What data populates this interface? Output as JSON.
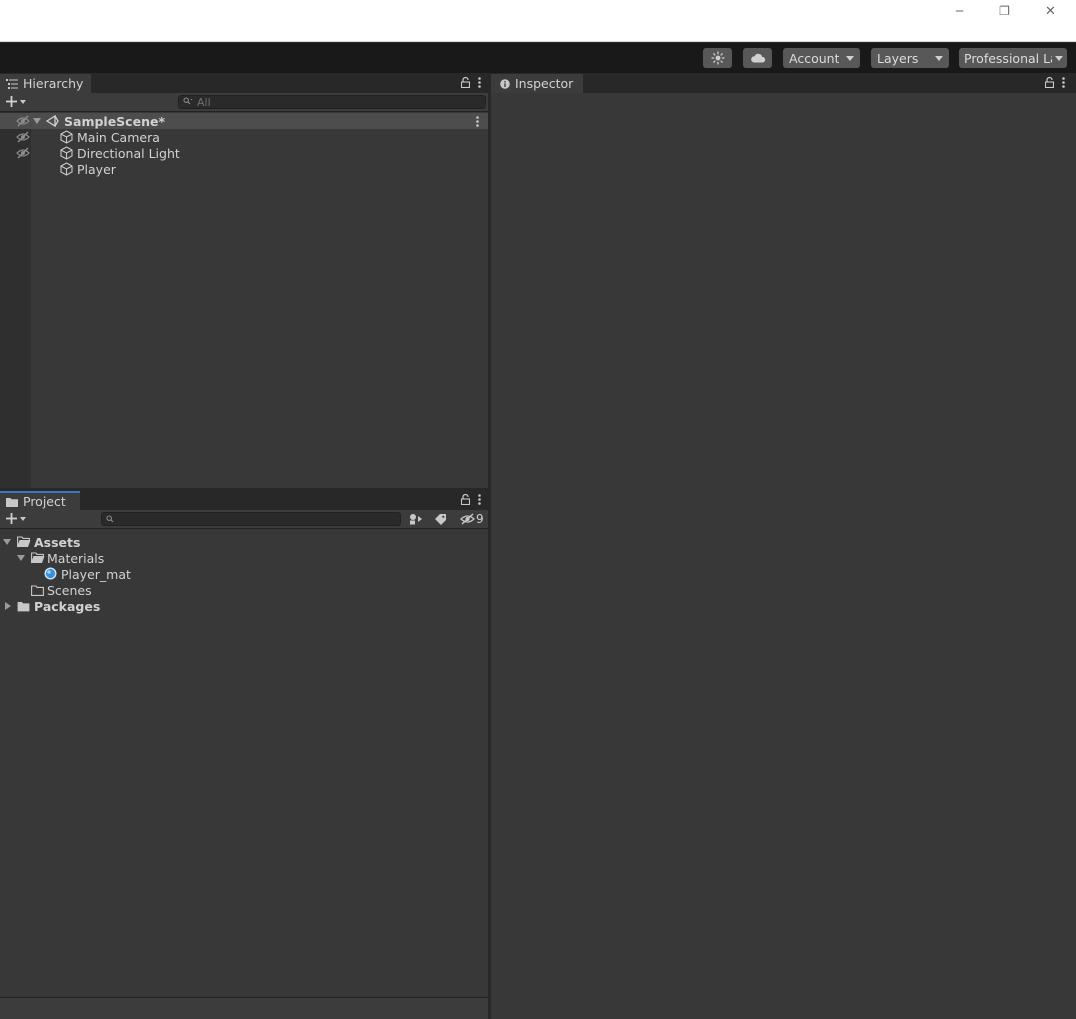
{
  "window": {
    "controls": {
      "minimize": "─",
      "restore": "❐",
      "close": "✕"
    }
  },
  "toolbar": {
    "account_label": "Account",
    "layers_label": "Layers",
    "layout_label": "Professional Layout"
  },
  "hierarchy": {
    "tab_label": "Hierarchy",
    "search_placeholder": "All",
    "scene": {
      "label": "SampleScene*"
    },
    "items": [
      {
        "label": "Main Camera"
      },
      {
        "label": "Directional Light"
      },
      {
        "label": "Player"
      }
    ]
  },
  "project": {
    "tab_label": "Project",
    "hidden_count": "9",
    "tree": {
      "assets": "Assets",
      "materials": "Materials",
      "player_mat": "Player_mat",
      "scenes": "Scenes",
      "packages": "Packages"
    }
  },
  "inspector": {
    "tab_label": "Inspector"
  },
  "colors": {
    "accent": "#3a79bb",
    "panel_bg": "#383838",
    "toolbar_bg": "#191919"
  }
}
